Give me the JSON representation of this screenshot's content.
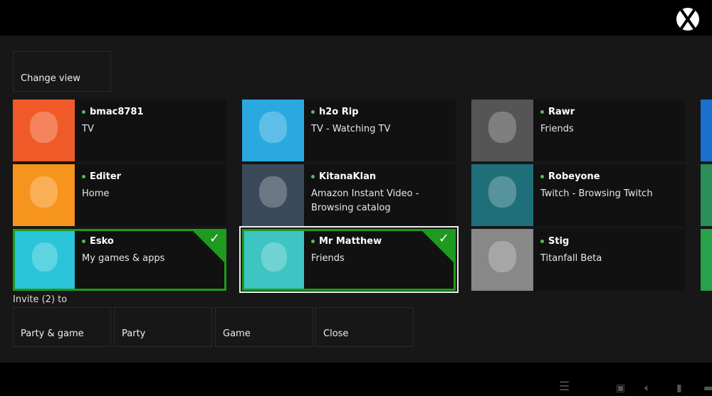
{
  "header": {
    "logo": "xbox-logo"
  },
  "change_view": "Change view",
  "friends": [
    {
      "name": "bmac8781",
      "status": "TV",
      "selected": false,
      "avatar_color": "#f05a28"
    },
    {
      "name": "h2o Rip",
      "status": "TV - Watching TV",
      "selected": false,
      "avatar_color": "#2aa9e0"
    },
    {
      "name": "Rawr",
      "status": "Friends",
      "selected": false,
      "avatar_color": "#555555"
    },
    {
      "name": "Editer",
      "status": "Home",
      "selected": false,
      "avatar_color": "#f7941d"
    },
    {
      "name": "KitanaKlan",
      "status": "Amazon Instant Video - Browsing catalog",
      "selected": false,
      "avatar_color": "#3a4a5a"
    },
    {
      "name": "Robeyone",
      "status": "Twitch - Browsing Twitch",
      "selected": false,
      "avatar_color": "#1f6f7a"
    },
    {
      "name": "Esko",
      "status": "My games & apps",
      "selected": true,
      "avatar_color": "#29c4d8"
    },
    {
      "name": "Mr Matthew",
      "status": "Friends",
      "selected": true,
      "avatar_color": "#3fc4c4"
    },
    {
      "name": "Stig",
      "status": "Titanfall Beta",
      "selected": false,
      "avatar_color": "#888888"
    }
  ],
  "invite_label": "Invite (2) to",
  "actions": [
    "Party & game",
    "Party",
    "Game",
    "Close"
  ],
  "check_glyph": "✓",
  "statusbar": {
    "icons": [
      "chat-icon",
      "tv-icon",
      "volume-icon",
      "mic-icon",
      "lock-icon"
    ]
  },
  "colors": {
    "accent": "#1e9a1e",
    "presence": "#5cb85c"
  }
}
